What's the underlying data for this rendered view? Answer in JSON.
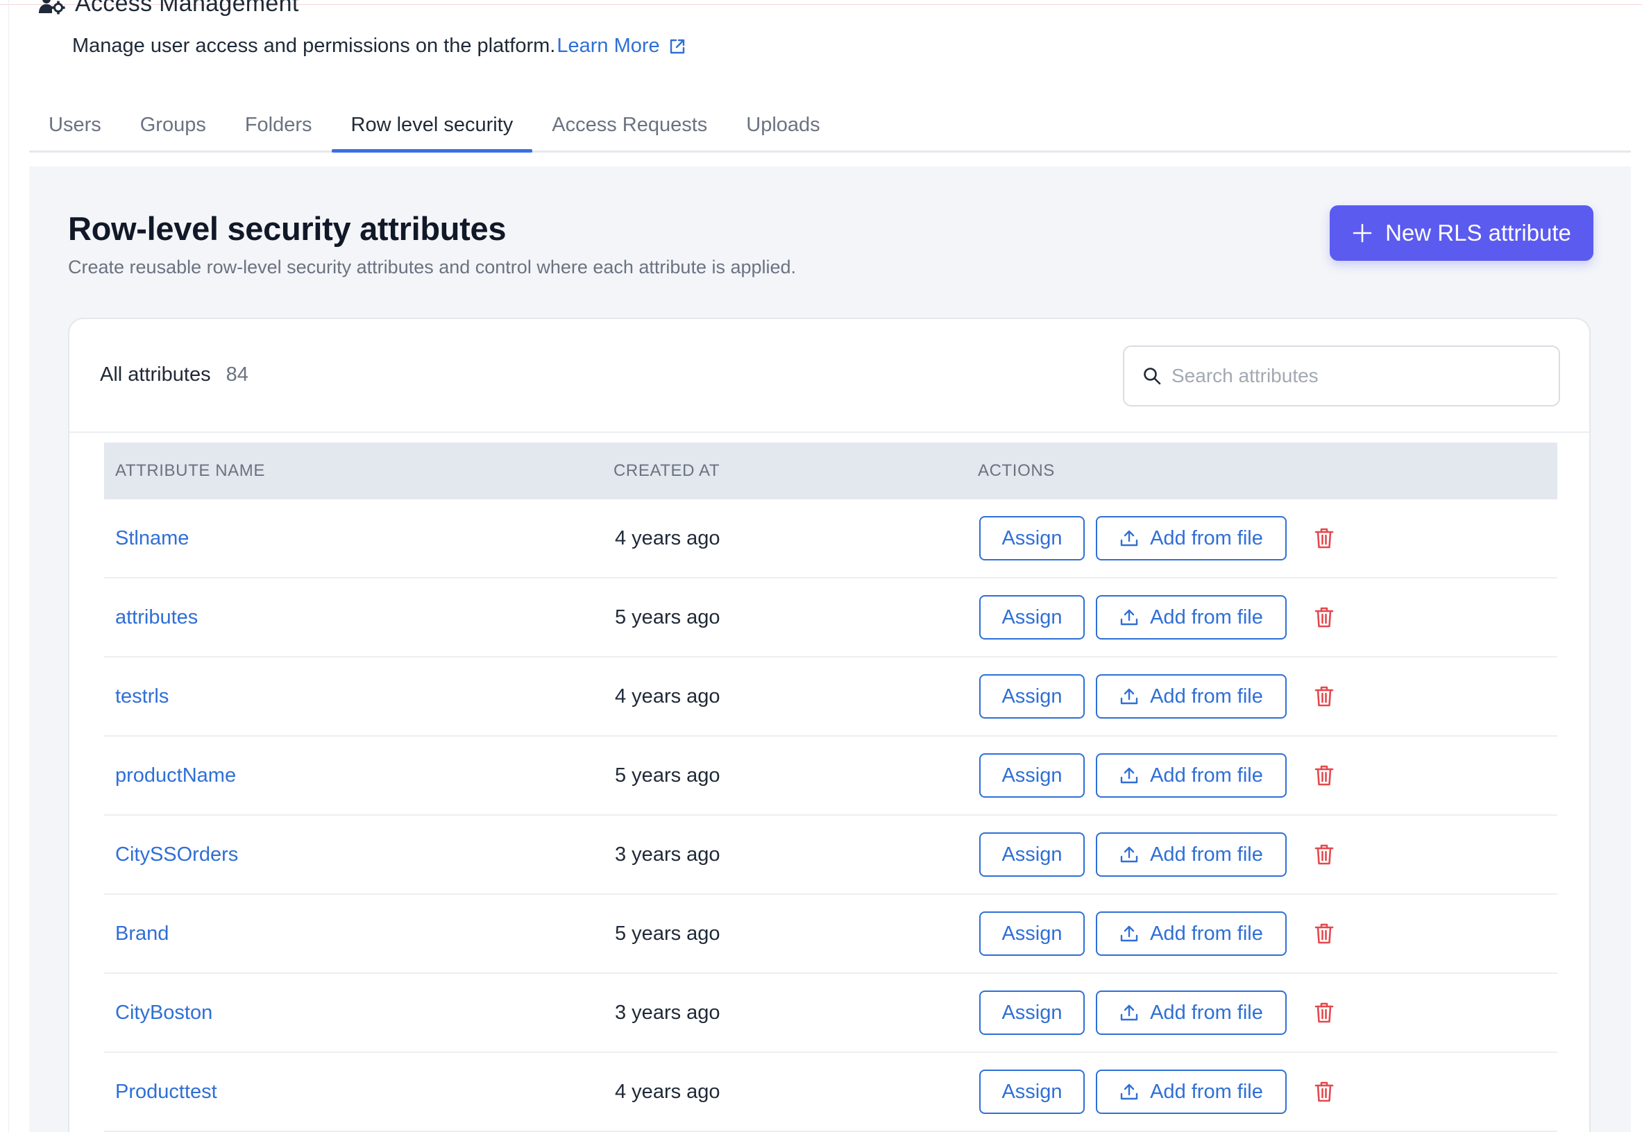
{
  "header": {
    "title": "Access Management",
    "subtitle": "Manage user access and permissions on the platform.",
    "learn_more": "Learn More",
    "icon": "users-gear-icon"
  },
  "tabs": [
    {
      "label": "Users",
      "active": false
    },
    {
      "label": "Groups",
      "active": false
    },
    {
      "label": "Folders",
      "active": false
    },
    {
      "label": "Row level security",
      "active": true
    },
    {
      "label": "Access Requests",
      "active": false
    },
    {
      "label": "Uploads",
      "active": false
    }
  ],
  "section": {
    "title": "Row-level security attributes",
    "description": "Create reusable row-level security attributes and control where each attribute is applied.",
    "new_button": "New RLS attribute"
  },
  "card": {
    "all_label": "All attributes",
    "count": "84",
    "search_placeholder": "Search attributes"
  },
  "table": {
    "columns": [
      "ATTRIBUTE NAME",
      "CREATED AT",
      "ACTIONS"
    ],
    "assign_label": "Assign",
    "add_file_label": "Add from file",
    "rows": [
      {
        "name": "Stlname",
        "created": "4 years ago"
      },
      {
        "name": "attributes",
        "created": "5 years ago"
      },
      {
        "name": "testrls",
        "created": "4 years ago"
      },
      {
        "name": "productName",
        "created": "5 years ago"
      },
      {
        "name": "CitySSOrders",
        "created": "3 years ago"
      },
      {
        "name": "Brand",
        "created": "5 years ago"
      },
      {
        "name": "CityBoston",
        "created": "3 years ago"
      },
      {
        "name": "Producttest",
        "created": "4 years ago"
      }
    ]
  },
  "colors": {
    "accent": "#5b5bf0",
    "link": "#2f6fd6",
    "danger": "#e5484d",
    "panel_bg": "#f3f5f9",
    "table_header_bg": "#e3e7ee"
  }
}
